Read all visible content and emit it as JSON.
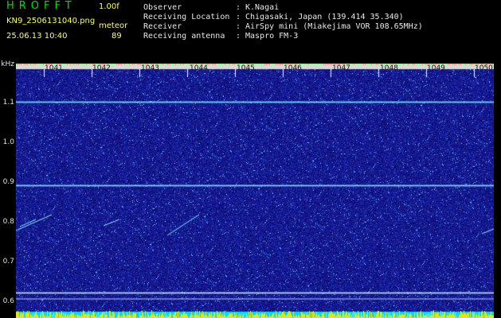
{
  "header": {
    "app_name": "HROFFT",
    "version": "1.00f",
    "filename": "KN9_2506131040.png",
    "datetime": "25.06.13 10:40",
    "meteor_label": "meteor",
    "meteor_count": "89"
  },
  "meta": [
    {
      "key": "Observer",
      "value": "K.Nagai"
    },
    {
      "key": "Receiving Location",
      "value": "Chigasaki, Japan (139.414 35.340)"
    },
    {
      "key": "Receiver",
      "value": "AirSpy mini (Miakejima VOR 108.65MHz)"
    },
    {
      "key": "Receiving antenna",
      "value": "Maspro FM-3"
    }
  ],
  "chart_data": {
    "type": "heatmap",
    "ylabel": "kHz",
    "y_ticks": [
      "1.1",
      "1.0",
      "0.9",
      "0.8",
      "0.7",
      "0.6"
    ],
    "x_ticks": [
      "1041",
      "1042",
      "1043",
      "1044",
      "1045",
      "1046",
      "1047",
      "1048",
      "1049",
      "1050"
    ],
    "horizontal_lines_khz": [
      1.1,
      0.89,
      0.62
    ],
    "colors": {
      "background": "#14148c",
      "line": "#6fd0ff",
      "bottom_band": "#e6e600"
    }
  }
}
